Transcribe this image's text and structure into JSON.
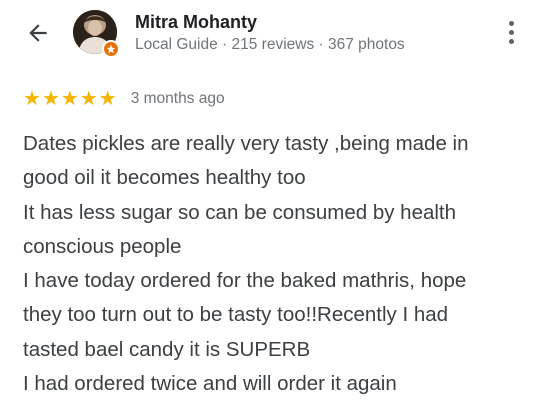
{
  "header": {
    "back_icon": "arrow-left-icon",
    "user_name": "Mitra Mohanty",
    "user_meta": "Local Guide · 215 reviews · 367 photos",
    "badge_icon": "local-guide-star-icon",
    "more_icon": "more-vert-icon"
  },
  "review": {
    "rating": 5,
    "rating_max": 5,
    "star_color": "#f4b400",
    "date": "3 months ago",
    "lines": [
      "Dates pickles are really very tasty ,being made in",
      "good oil it becomes healthy too",
      "It has less sugar so can be consumed by health",
      "conscious people",
      "I have today ordered for the baked mathris, hope",
      "they too turn out to be tasty too!!Recently I had",
      "tasted bael candy it is SUPERB",
      "I had ordered twice and will order it again"
    ]
  },
  "colors": {
    "guide_badge": "#e8710a",
    "meta_text": "#70757a",
    "body_text": "#3c4043"
  }
}
